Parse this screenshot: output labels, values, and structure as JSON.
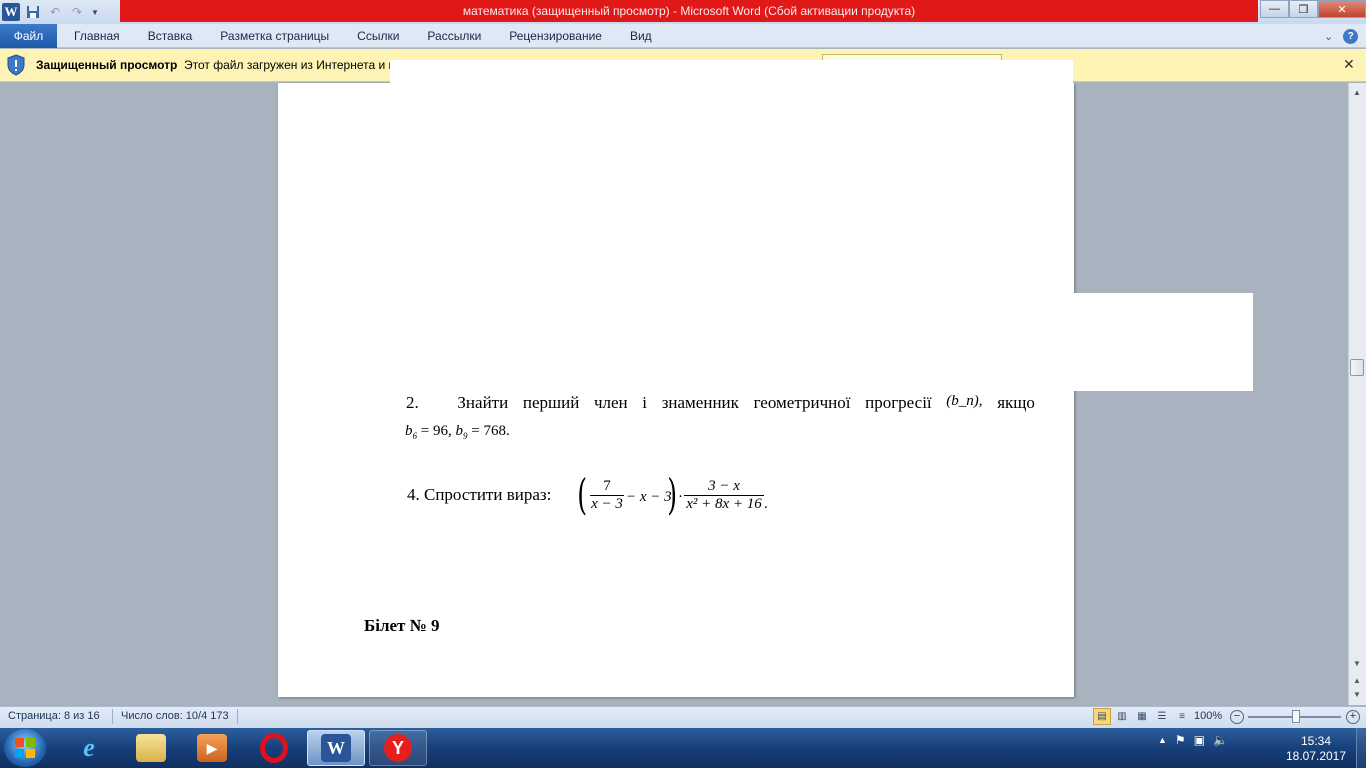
{
  "window": {
    "title": "математика (защищенный просмотр)  -  Microsoft Word (Сбой активации продукта)",
    "controls": {
      "minimize": "—",
      "maximize": "❐",
      "close": "✕"
    }
  },
  "qat": {
    "word_icon": "W",
    "save_icon": "save-icon",
    "undo_icon": "undo-icon",
    "redo_icon": "redo-icon",
    "customize_icon": "chevron-down-icon"
  },
  "ribbon": {
    "file_tab": "Файл",
    "tabs": [
      "Главная",
      "Вставка",
      "Разметка страницы",
      "Ссылки",
      "Рассылки",
      "Рецензирование",
      "Вид"
    ]
  },
  "protected_view": {
    "title": "Защищенный просмотр",
    "message": "Этот файл загружен из Интернета и мо",
    "close": "✕"
  },
  "document": {
    "task2_words": [
      "2.",
      "Знайти",
      "перший",
      "член",
      "і",
      "знаменник",
      "геометричної",
      "прогресії",
      "(b_n),",
      "якщо"
    ],
    "task2_line2": {
      "b6_value": "96",
      "b9_value": "768",
      "b6_sub": "6",
      "b9_sub": "9"
    },
    "task4_label": "4.  Спростити вираз:",
    "formula": {
      "frac1_num": "7",
      "frac1_den": "x − 3",
      "mid": "− x − 3",
      "frac2_num": "3 − x",
      "frac2_den": "x² + 8x + 16"
    },
    "ticket": "Білет № 9"
  },
  "statusbar": {
    "page": "Страница: 8 из 16",
    "words": "Число слов: 10/4 173",
    "zoom": "100%",
    "zoom_minus": "−",
    "zoom_plus": "+"
  },
  "taskbar": {
    "apps": [
      "internet-explorer-icon",
      "file-explorer-icon",
      "media-player-icon",
      "opera-icon",
      "word-icon",
      "yandex-browser-icon"
    ],
    "time": "15:34",
    "date": "18.07.2017"
  },
  "colors": {
    "title_red": "#e01818",
    "protected_bar": "#fdf3b5",
    "file_tab": "#2a62b0",
    "workspace": "#a9b3c0"
  }
}
